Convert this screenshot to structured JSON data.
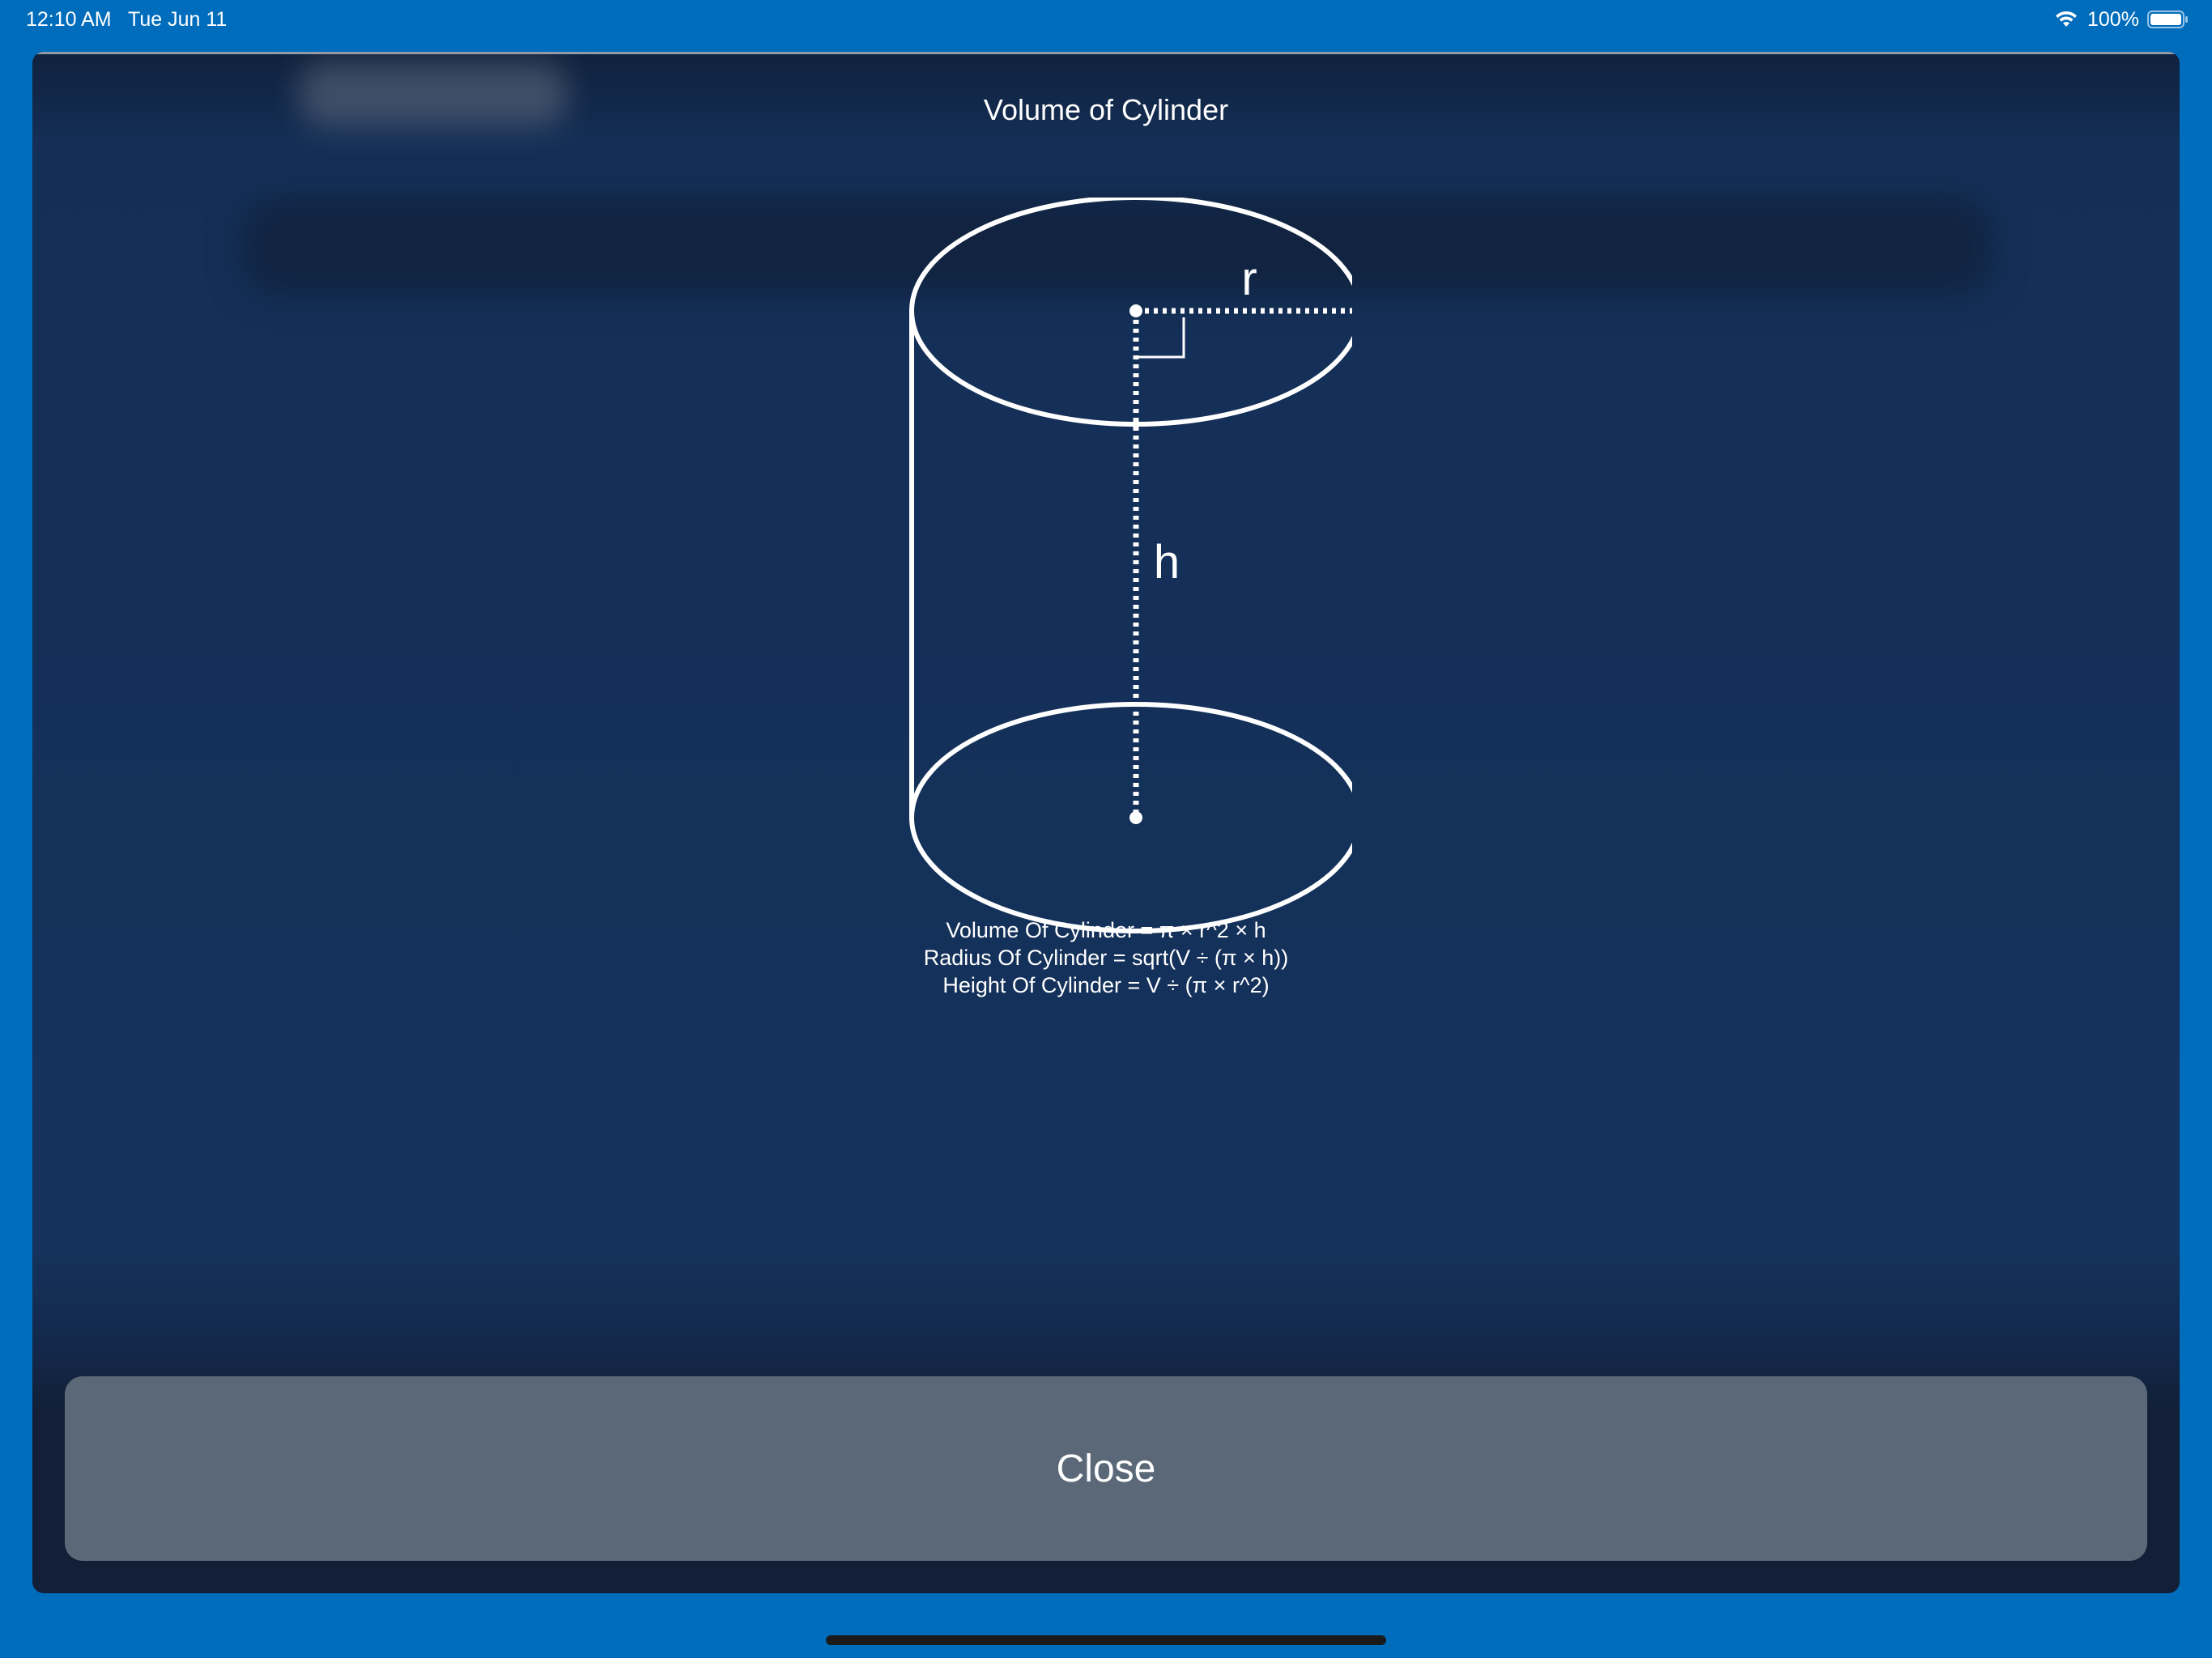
{
  "status_bar": {
    "time": "12:10 AM",
    "date": "Tue Jun 11",
    "battery_percent": "100%",
    "battery_level": 1.0,
    "icons": [
      "wifi-icon",
      "battery-icon"
    ]
  },
  "modal": {
    "title": "Volume of Cylinder",
    "diagram_labels": {
      "radius": "r",
      "height": "h"
    },
    "formulas": [
      "Volume Of Cylinder = π × r^2 × h",
      "Radius Of Cylinder = sqrt(V ÷ (π × h))",
      "Height Of Cylinder = V ÷ (π × r^2)"
    ],
    "close_label": "Close"
  },
  "colors": {
    "outer_background": "#006cbc",
    "sheet_background": "#14325c",
    "close_button": "#5a6878",
    "text": "#ffffff"
  }
}
